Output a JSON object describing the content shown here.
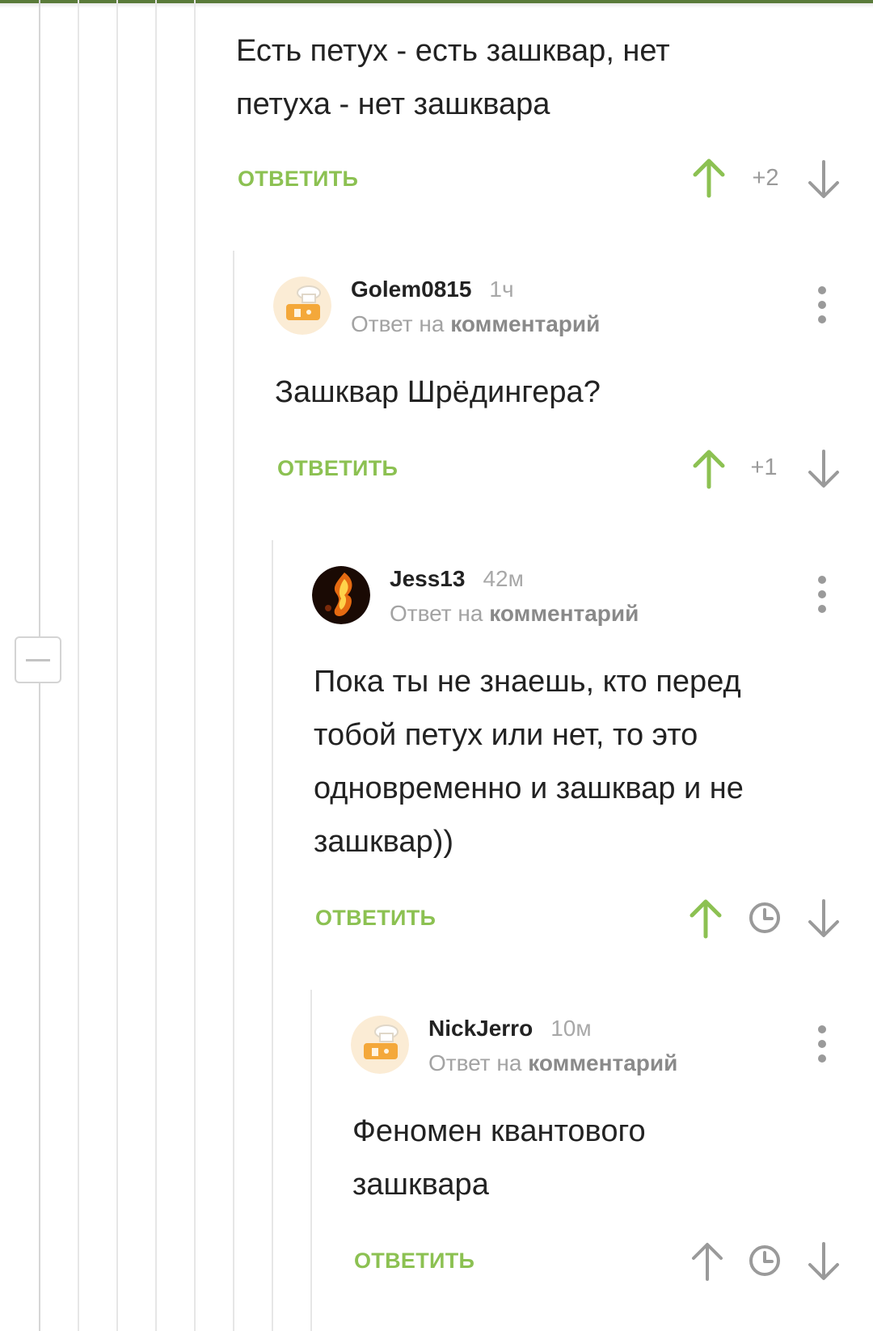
{
  "thread": {
    "collapse_label": "−"
  },
  "comments": [
    {
      "text": [
        "Есть петух - есть зашквар, нет",
        "петуха - нет зашквара"
      ],
      "reply_label": "ОТВЕТИТЬ",
      "score": "+2",
      "vote_up_color": "#8cc152"
    },
    {
      "username": "Golem0815",
      "time": "1ч",
      "reply_prefix": "Ответ на",
      "reply_link": "комментарий",
      "avatar_icon": "chef-avatar-icon",
      "text": [
        "Зашквар Шрёдингера?"
      ],
      "reply_label": "ОТВЕТИТЬ",
      "score": "+1",
      "vote_up_color": "#8cc152"
    },
    {
      "username": "Jess13",
      "time": "42м",
      "reply_prefix": "Ответ на",
      "reply_link": "комментарий",
      "avatar_icon": "fire-avatar-icon",
      "text": [
        "Пока ты не знаешь, кто перед",
        "тобой петух или нет, то это",
        "одновременно и зашквар и не",
        "зашквар))"
      ],
      "reply_label": "ОТВЕТИТЬ",
      "score_icon": "clock-icon",
      "vote_up_color": "#8cc152"
    },
    {
      "username": "NickJerro",
      "time": "10м",
      "reply_prefix": "Ответ на",
      "reply_link": "комментарий",
      "avatar_icon": "chef-avatar-icon",
      "text": [
        "Феномен квантового",
        "зашквара"
      ],
      "reply_label": "ОТВЕТИТЬ",
      "score_icon": "clock-icon",
      "vote_up_color": "#9a9a9a"
    }
  ],
  "colors": {
    "accent_green": "#8cc152",
    "top_bar": "#5a7b3a",
    "muted": "#9a9a9a"
  }
}
